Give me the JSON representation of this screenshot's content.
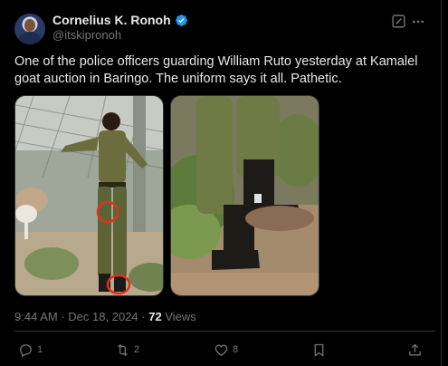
{
  "author": {
    "display_name": "Cornelius K. Ronoh",
    "handle": "@itskipronoh",
    "verified": true
  },
  "tweet": {
    "text": "One of the police officers guarding William Ruto yesterday at Kamalel goat auction in Baringo. The uniform says it all. Pathetic."
  },
  "media": [
    {
      "alt": "photo-officer-standing-by-fence"
    },
    {
      "alt": "photo-closeup-boots"
    }
  ],
  "meta": {
    "time": "9:44 AM",
    "separator": "·",
    "date": "Dec 18, 2024",
    "views_count": "72",
    "views_label": "Views"
  },
  "actions": {
    "replies": "1",
    "reposts": "2",
    "likes": "8"
  },
  "icons": {
    "verified": "verified-badge-icon",
    "grok": "grok-icon",
    "more": "more-dots-icon",
    "reply": "reply-icon",
    "repost": "repost-icon",
    "like": "heart-icon",
    "bookmark": "bookmark-icon",
    "share": "share-icon"
  },
  "colors": {
    "background": "#000000",
    "text": "#e7e9ea",
    "muted": "#71767b",
    "verified": "#1d9bf0",
    "annotation_circle": "#e0301e"
  }
}
